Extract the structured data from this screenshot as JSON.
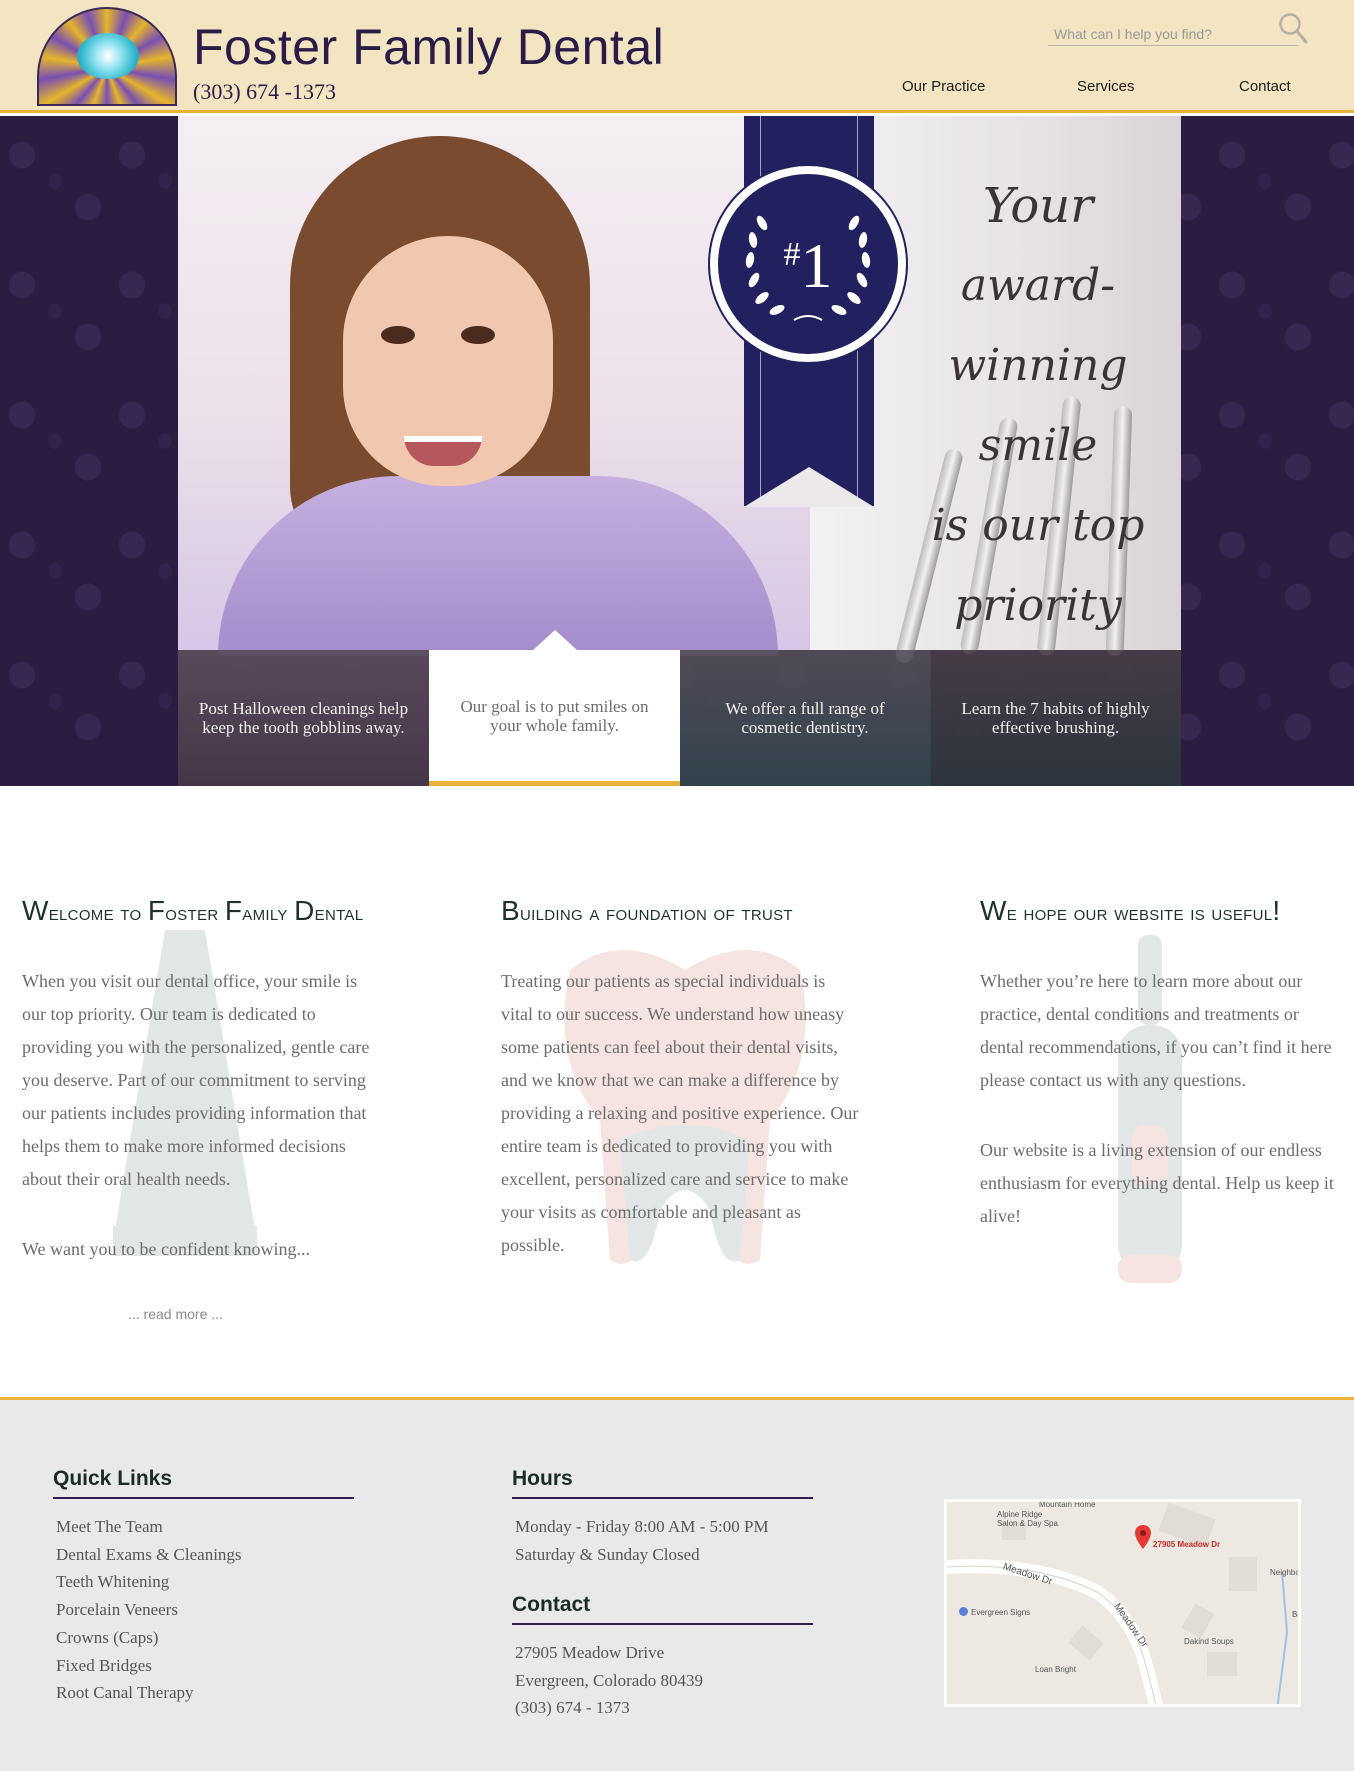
{
  "header": {
    "title": "Foster Family Dental",
    "phone": "(303) 674 -1373",
    "search_placeholder": "What can I help you find?",
    "nav": [
      {
        "label": "Our Practice"
      },
      {
        "label": "Services"
      },
      {
        "label": "Contact"
      }
    ]
  },
  "hero": {
    "medal_hash": "#",
    "medal_number": "1",
    "tagline": [
      "Your",
      "award-winning",
      "smile",
      "is our top",
      "priority"
    ],
    "tabs": [
      {
        "text": "Post Halloween cleanings help keep the tooth gobblins away."
      },
      {
        "text": "Our goal is to put smiles on your whole family."
      },
      {
        "text": "We offer a full range of cosmetic dentistry."
      },
      {
        "text": "Learn the 7 habits of highly effective brushing."
      }
    ]
  },
  "content": {
    "col1": {
      "title_first": "W",
      "title_rest1": "elcome to ",
      "title_f": "F",
      "title_rest2": "oster ",
      "title_fam": "F",
      "title_rest3": "amily ",
      "title_d": "D",
      "title_rest4": "ental",
      "p1": "When you visit our dental office, your smile is our top priority.  Our team is dedicated to providing you with the personalized, gentle care you deserve.  Part of our commitment to serving our patients includes providing information that helps them to make more informed decisions about their oral health needs.",
      "p2": "We want you to be confident knowing...",
      "read_more": "... read more ..."
    },
    "col2": {
      "title_first": "B",
      "title_rest": "uilding a foundation of trust",
      "p1": "Treating our patients as special individuals is vital to our success. We understand how uneasy some patients can feel about their dental visits, and we know that we can make a difference by providing a relaxing and positive experience. Our entire team is dedicated to providing you with excellent, personalized care and service to make your visits as comfortable and pleasant as possible."
    },
    "col3": {
      "title_first": "W",
      "title_rest": "e hope our website is useful",
      "title_bang": "!",
      "p1": "Whether you’re here to learn more about our practice, dental conditions and treatments or dental recommendations, if you can’t find it here please contact us with any questions.",
      "p2": "Our website is a living extension of our endless enthusiasm for everything dental. Help us keep it alive!"
    }
  },
  "footer": {
    "quick_links_title": "Quick Links",
    "quick_links": [
      {
        "label": "Meet The Team"
      },
      {
        "label": "Dental Exams & Cleanings"
      },
      {
        "label": "Teeth Whitening"
      },
      {
        "label": "Porcelain Veneers"
      },
      {
        "label": "Crowns (Caps)"
      },
      {
        "label": "Fixed Bridges"
      },
      {
        "label": "Root Canal Therapy"
      }
    ],
    "hours_title": "Hours",
    "hours": [
      {
        "text": "Monday - Friday  8:00 AM - 5:00 PM"
      },
      {
        "text": "Saturday & Sunday  Closed"
      }
    ],
    "contact_title": "Contact",
    "contact": [
      {
        "text": "27905 Meadow Drive"
      },
      {
        "text": "Evergreen, Colorado 80439"
      },
      {
        "text": "(303) 674 - 1373"
      }
    ],
    "map": {
      "labels": [
        {
          "text": "Mountain Home"
        },
        {
          "text": "Alpine Ridge"
        },
        {
          "text": "Salon & Day Spa"
        },
        {
          "text": "27905 Meadow Dr"
        },
        {
          "text": "Neighbo"
        },
        {
          "text": "Meadow Dr"
        },
        {
          "text": "Meadow Dr"
        },
        {
          "text": "Evergreen Signs"
        },
        {
          "text": "Be"
        },
        {
          "text": "Dakind Soups"
        },
        {
          "text": "Loan Bright"
        }
      ],
      "pin_color": "#e53935",
      "road_color": "#ffffff"
    }
  },
  "colors": {
    "header_bg": "#f3e4c2",
    "accent": "#e8b23b",
    "ribbon": "#22205e",
    "hero_bg": "#2b1c42"
  }
}
